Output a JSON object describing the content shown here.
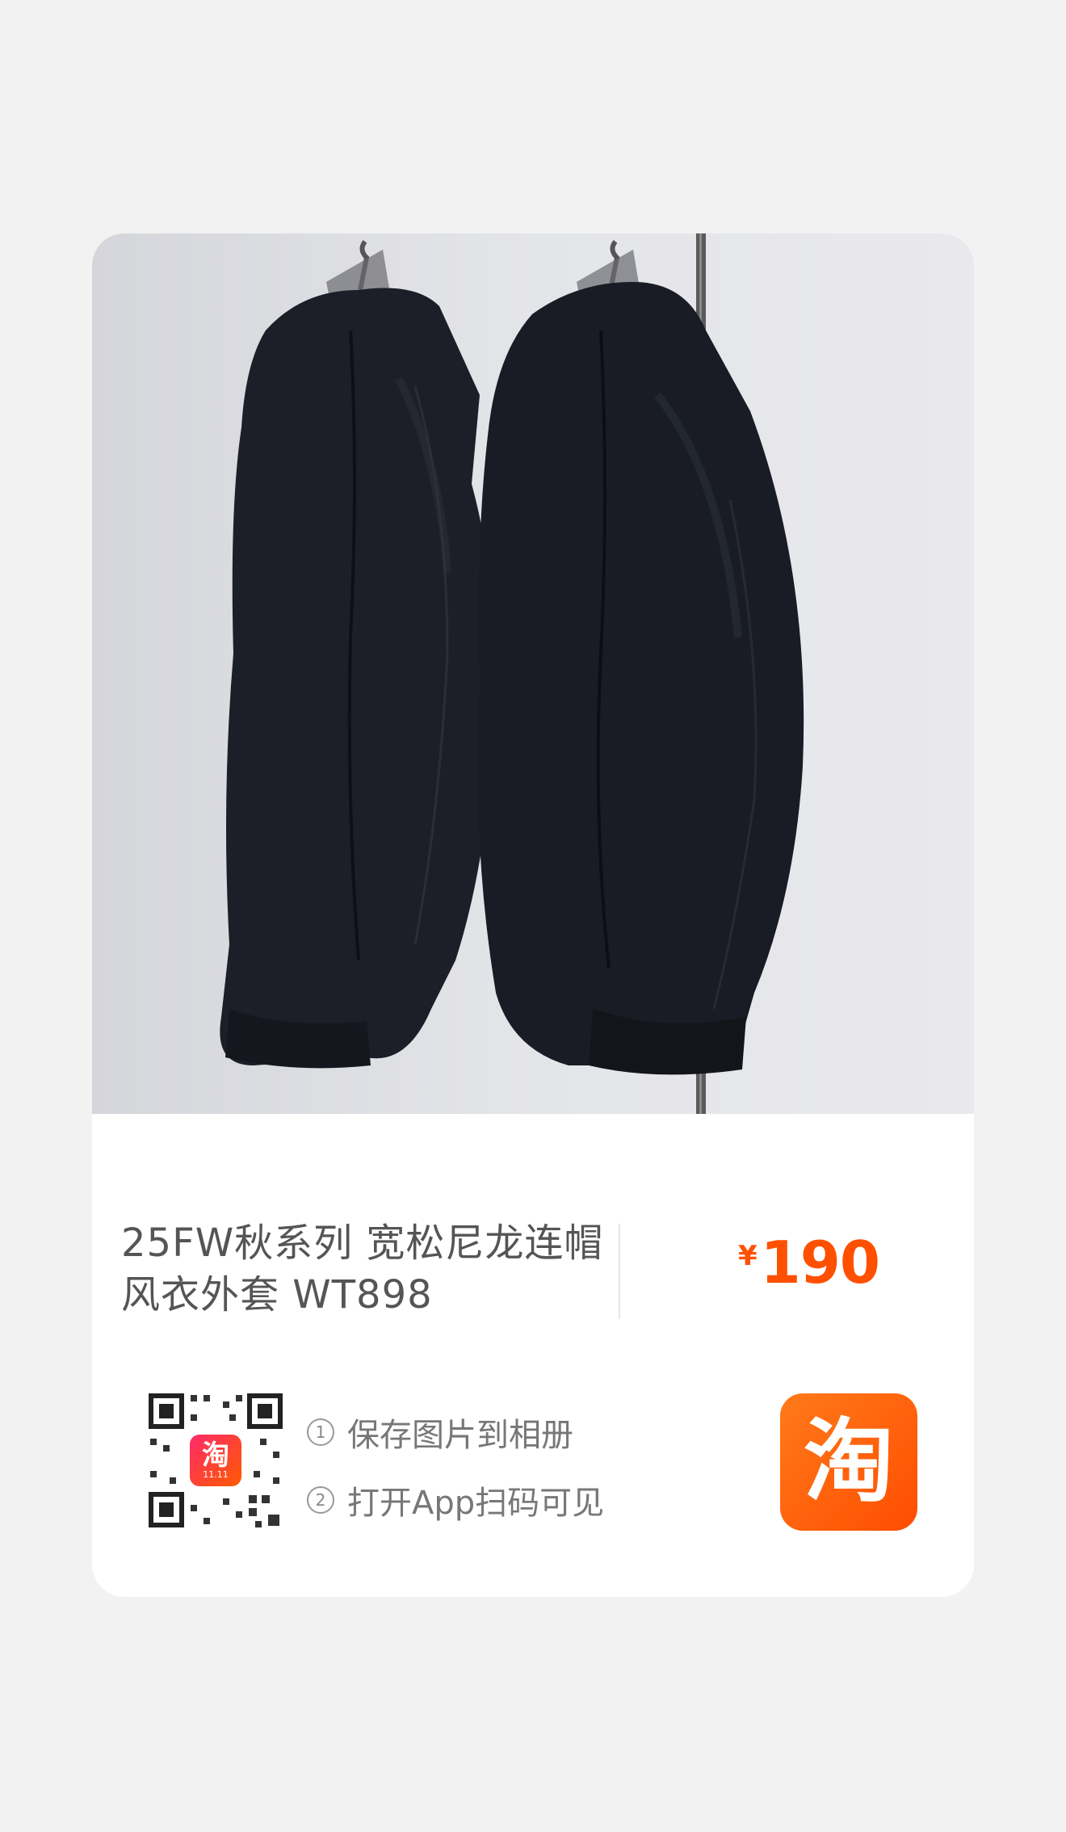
{
  "product": {
    "title_line1": "25FW秋系列 宽松尼龙连帽",
    "title_line2": "风衣外套 WT898",
    "currency_symbol": "¥",
    "price": "190"
  },
  "share": {
    "step1_num": "1",
    "step1": "保存图片到相册",
    "step2_num": "2",
    "step2": "打开App扫码可见",
    "qr_badge_char": "淘",
    "qr_badge_sub": "11.11",
    "app_logo_char": "淘"
  },
  "colors": {
    "accent": "#ff5000",
    "logo_gradient_start": "#ff7a1a",
    "logo_gradient_end": "#ff4d00",
    "page_bg": "#f2f2f2"
  },
  "icons": {
    "photo": "product-photo-two-black-jackets-on-hangers",
    "qr": "qr-code",
    "app_logo": "taobao-logo"
  }
}
